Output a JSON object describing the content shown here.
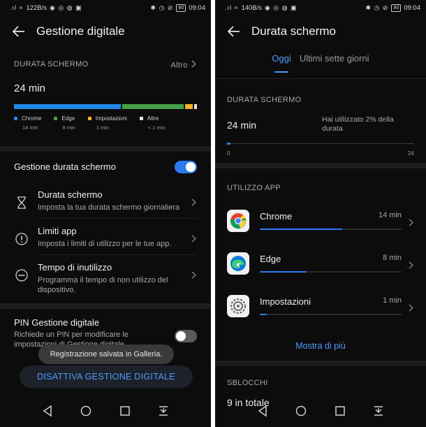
{
  "left": {
    "status": {
      "speed": "122B/s",
      "time": "09:04",
      "battery": "80"
    },
    "title": "Gestione digitale",
    "usage": {
      "label": "DURATA SCHERMO",
      "more": "Altro",
      "value": "24 min",
      "segments": [
        {
          "name": "Chrome",
          "minutes": 14,
          "color": "#1e88e5"
        },
        {
          "name": "Edge",
          "minutes": 8,
          "color": "#43a047"
        },
        {
          "name": "Impostazioni",
          "minutes": 1,
          "color": "#fbb12c"
        },
        {
          "name": "Altre",
          "minutes": 0.4,
          "color": "#e6e6e6"
        }
      ],
      "legend": [
        {
          "name": "Chrome",
          "time": "14 min",
          "color": "#1e88e5"
        },
        {
          "name": "Edge",
          "time": "8 min",
          "color": "#43a047"
        },
        {
          "name": "Impostazioni",
          "time": "1 min",
          "color": "#fbb12c"
        },
        {
          "name": "Altre",
          "time": "< 1 min",
          "color": "#e6e6e6"
        }
      ]
    },
    "toggle_label": "Gestione durata schermo",
    "toggle_on": true,
    "menu": [
      {
        "title": "Durata schermo",
        "desc": "Imposta la tua durata schermo giornaliera",
        "icon": "hourglass-icon"
      },
      {
        "title": "Limiti app",
        "desc": "Imposta i limiti di utilizzo per le tue app.",
        "icon": "alert-circle-icon"
      },
      {
        "title": "Tempo di inutilizzo",
        "desc": "Programma il tempo di non utilizzo del dispositivo.",
        "icon": "minus-circle-icon"
      }
    ],
    "pin": {
      "title": "PIN Gestione digitale",
      "desc": "Richiede un PIN per modificare le impostazioni di Gestione digitale",
      "on": false
    },
    "toast": "Registrazione salvata in Galleria.",
    "deactivate": "DISATTIVA GESTIONE DIGITALE"
  },
  "right": {
    "status": {
      "speed": "140B/s",
      "time": "09:04",
      "battery": "80"
    },
    "title": "Durata schermo",
    "tabs": [
      "Oggi",
      "Ultimi sette giorni"
    ],
    "usage": {
      "label": "DURATA SCHERMO",
      "value": "24 min",
      "note": "Hai utilizzato 2% della durata",
      "fraction": 0.02,
      "axis_min": "0",
      "axis_max": "24"
    },
    "apps_label": "UTILIZZO APP",
    "apps": [
      {
        "name": "Chrome",
        "time": "14 min",
        "fraction": 0.58,
        "icon": "chrome-icon"
      },
      {
        "name": "Edge",
        "time": "8 min",
        "fraction": 0.33,
        "icon": "edge-icon"
      },
      {
        "name": "Impostazioni",
        "time": "1 min",
        "fraction": 0.05,
        "icon": "settings-icon"
      }
    ],
    "show_more": "Mostra di più",
    "unlocks_label": "SBLOCCHI",
    "unlocks_value": "9 in totale"
  }
}
